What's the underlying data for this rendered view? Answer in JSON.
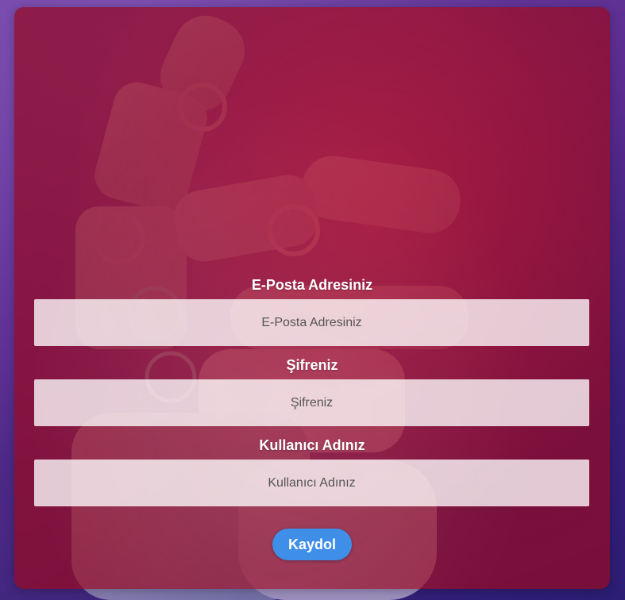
{
  "form": {
    "email": {
      "label": "E-Posta Adresiniz",
      "placeholder": "E-Posta Adresiniz",
      "value": ""
    },
    "password": {
      "label": "Şifreniz",
      "placeholder": "Şifreniz",
      "value": ""
    },
    "username": {
      "label": "Kullanıcı Adınız",
      "placeholder": "Kullanıcı Adınız",
      "value": ""
    },
    "submit_label": "Kaydol"
  },
  "colors": {
    "card_overlay": "#960a23",
    "button": "#3f8fe8",
    "page_background": "#5a2b8f"
  }
}
